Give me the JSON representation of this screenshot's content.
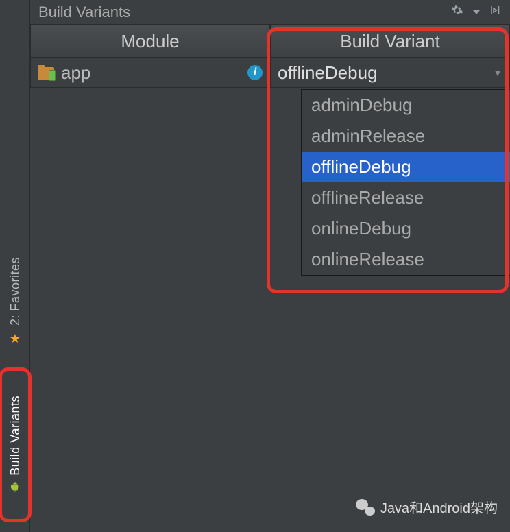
{
  "panel": {
    "title": "Build Variants"
  },
  "columns": {
    "module": "Module",
    "variant": "Build Variant"
  },
  "row": {
    "module_name": "app",
    "selected_variant": "offlineDebug"
  },
  "dropdown": {
    "items": [
      {
        "label": "adminDebug",
        "selected": false
      },
      {
        "label": "adminRelease",
        "selected": false
      },
      {
        "label": "offlineDebug",
        "selected": true
      },
      {
        "label": "offlineRelease",
        "selected": false
      },
      {
        "label": "onlineDebug",
        "selected": false
      },
      {
        "label": "onlineRelease",
        "selected": false
      }
    ]
  },
  "sidebar": {
    "favorites": {
      "label": "2: Favorites"
    },
    "build_variants": {
      "label": "Build Variants"
    }
  },
  "watermark": {
    "text": "Java和Android架构"
  }
}
